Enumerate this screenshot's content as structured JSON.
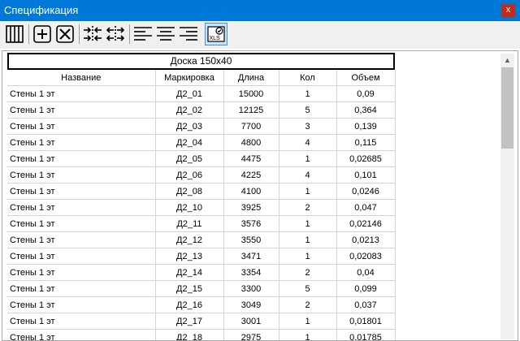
{
  "window": {
    "title": "Спецификация",
    "close_label": "x"
  },
  "toolbar": {
    "xls_label": "XLS"
  },
  "table": {
    "group_header": "Доска 150x40",
    "columns": [
      "Название",
      "Маркировка",
      "Длина",
      "Кол",
      "Объем"
    ],
    "rows": [
      [
        "Стены 1 эт",
        "Д2_01",
        "15000",
        "1",
        "0,09"
      ],
      [
        "Стены 1 эт",
        "Д2_02",
        "12125",
        "5",
        "0,364"
      ],
      [
        "Стены 1 эт",
        "Д2_03",
        "7700",
        "3",
        "0,139"
      ],
      [
        "Стены 1 эт",
        "Д2_04",
        "4800",
        "4",
        "0,115"
      ],
      [
        "Стены 1 эт",
        "Д2_05",
        "4475",
        "1",
        "0,02685"
      ],
      [
        "Стены 1 эт",
        "Д2_06",
        "4225",
        "4",
        "0,101"
      ],
      [
        "Стены 1 эт",
        "Д2_08",
        "4100",
        "1",
        "0,0246"
      ],
      [
        "Стены 1 эт",
        "Д2_10",
        "3925",
        "2",
        "0,047"
      ],
      [
        "Стены 1 эт",
        "Д2_11",
        "3576",
        "1",
        "0,02146"
      ],
      [
        "Стены 1 эт",
        "Д2_12",
        "3550",
        "1",
        "0,0213"
      ],
      [
        "Стены 1 эт",
        "Д2_13",
        "3471",
        "1",
        "0,02083"
      ],
      [
        "Стены 1 эт",
        "Д2_14",
        "3354",
        "2",
        "0,04"
      ],
      [
        "Стены 1 эт",
        "Д2_15",
        "3300",
        "5",
        "0,099"
      ],
      [
        "Стены 1 эт",
        "Д2_16",
        "3049",
        "2",
        "0,037"
      ],
      [
        "Стены 1 эт",
        "Д2_17",
        "3001",
        "1",
        "0,01801"
      ],
      [
        "Стены 1 эт",
        "Д2_18",
        "2975",
        "1",
        "0,01785"
      ]
    ]
  },
  "colors": {
    "titlebar": "#0078d7",
    "close": "#c42b1c",
    "toolbar": "#f0f0f0"
  }
}
